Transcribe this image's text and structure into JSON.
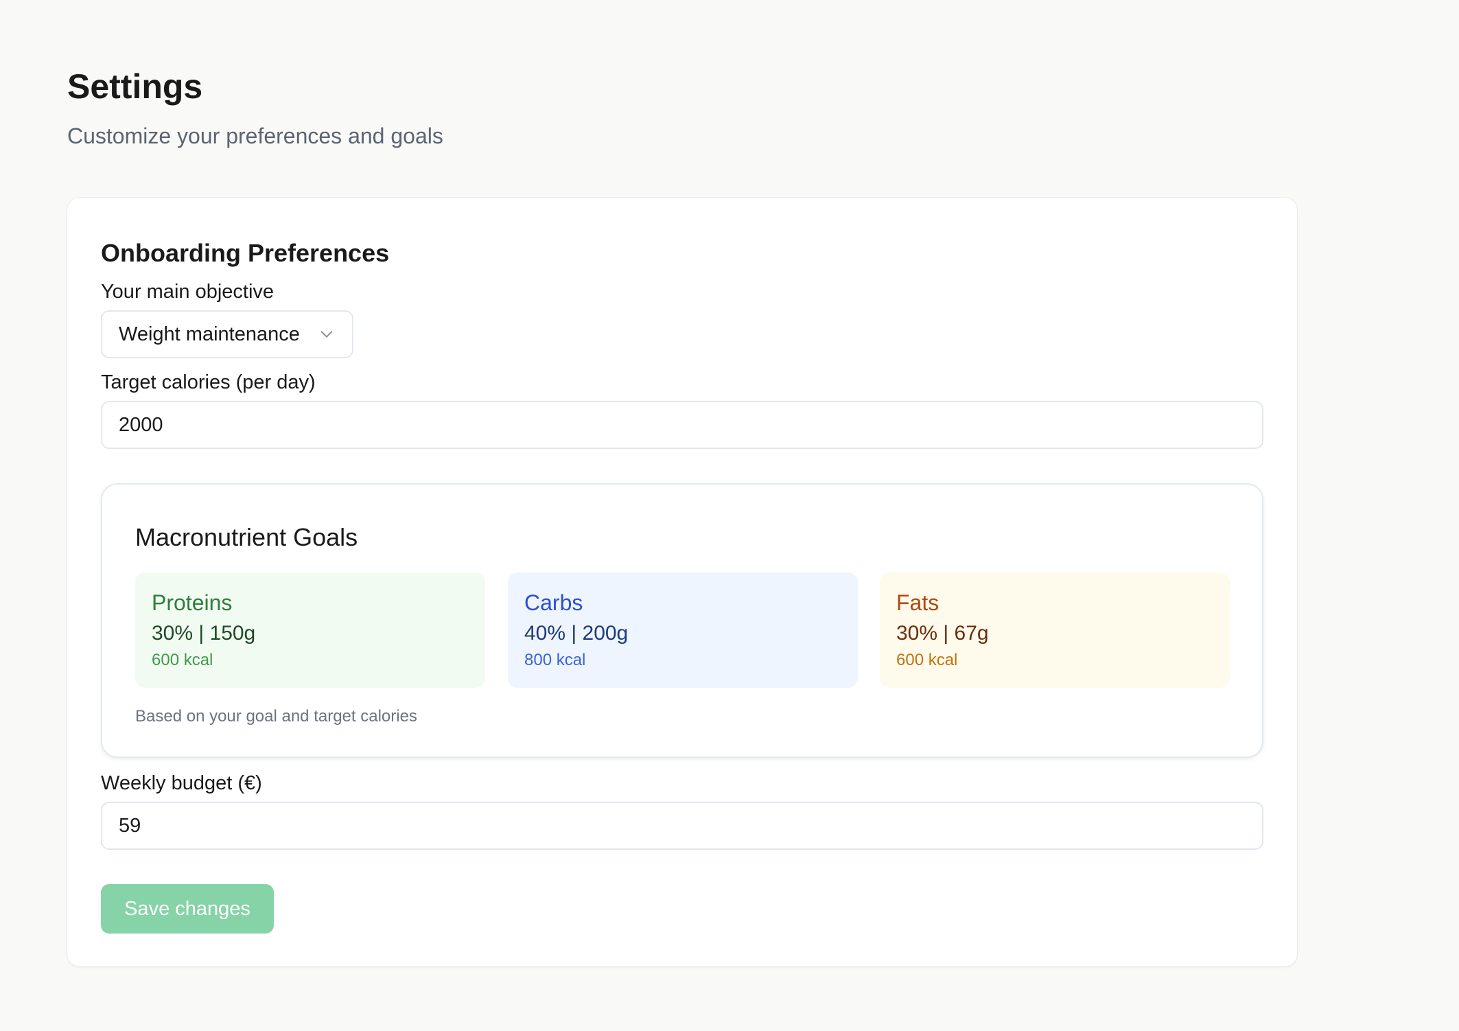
{
  "header": {
    "title": "Settings",
    "subtitle": "Customize your preferences and goals"
  },
  "card": {
    "title": "Onboarding Preferences",
    "objective": {
      "label": "Your main objective",
      "selected": "Weight maintenance",
      "icon": "chevron-down-icon"
    },
    "calories": {
      "label": "Target calories (per day)",
      "value": "2000"
    },
    "macros": {
      "title": "Macronutrient Goals",
      "items": [
        {
          "name": "Proteins",
          "values": "30% | 150g",
          "kcal": "600 kcal",
          "color": "#2f7d3a",
          "bg": "#f1fbf2"
        },
        {
          "name": "Carbs",
          "values": "40% | 200g",
          "kcal": "800 kcal",
          "color": "#2a4fd6",
          "bg": "#eef5fe"
        },
        {
          "name": "Fats",
          "values": "30% | 67g",
          "kcal": "600 kcal",
          "color": "#b0480f",
          "bg": "#fefbec"
        }
      ],
      "note": "Based on your goal and target calories"
    },
    "budget": {
      "label": "Weekly budget (€)",
      "value": "59"
    },
    "save_label": "Save changes"
  },
  "colors": {
    "page_background": "#f9f9f8",
    "save_button": "#86d3a8"
  }
}
